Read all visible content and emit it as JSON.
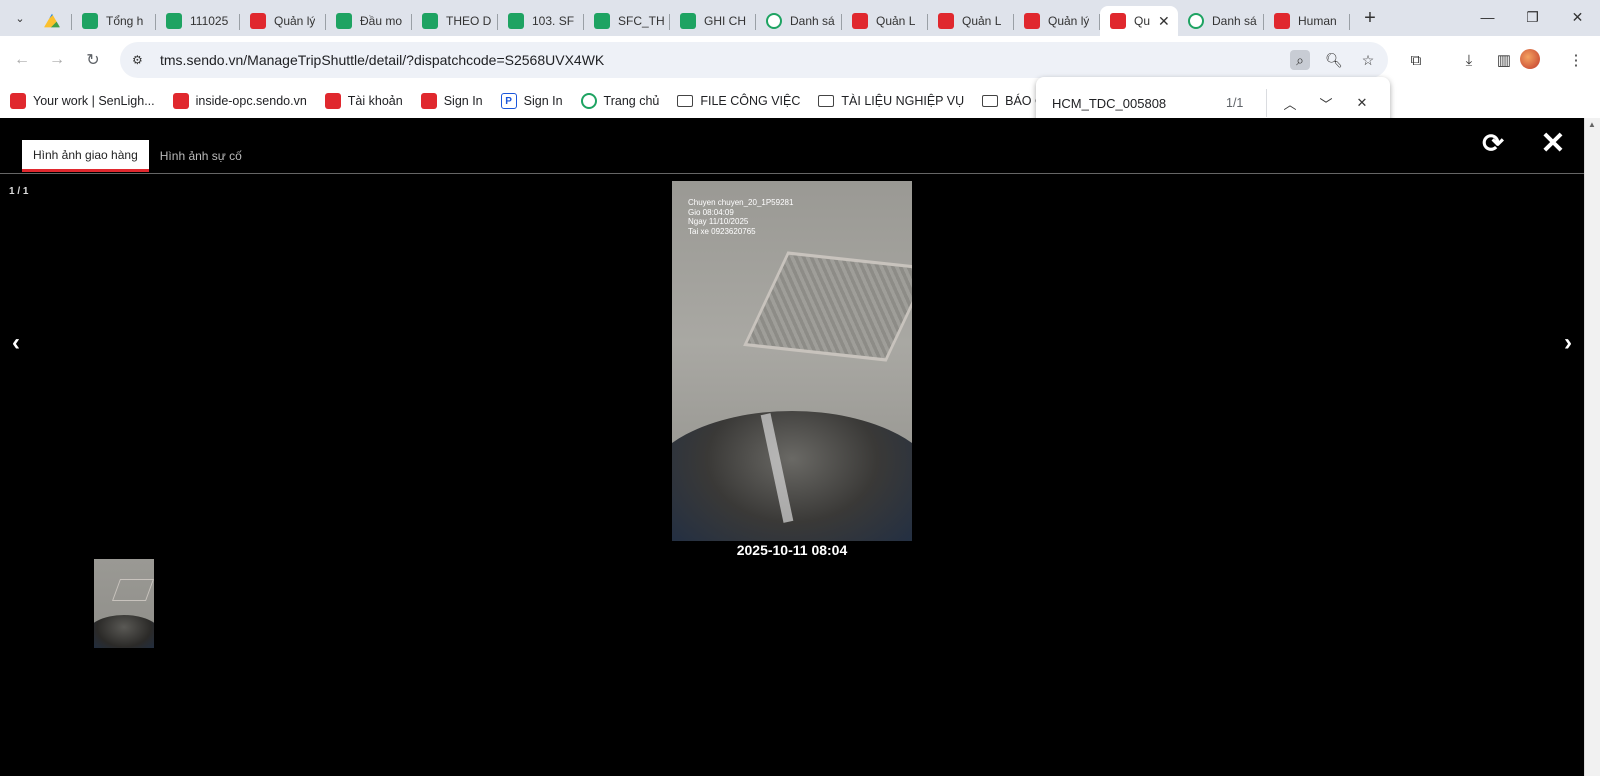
{
  "browser": {
    "tabs": [
      {
        "label": "",
        "icon": "google-drive-icon",
        "active": false
      },
      {
        "label": "Tổng h",
        "icon": "sheets-icon",
        "active": false
      },
      {
        "label": "111025",
        "icon": "sheets-icon",
        "active": false
      },
      {
        "label": "Quản lý",
        "icon": "sendo-icon",
        "active": false
      },
      {
        "label": "Đầu mo",
        "icon": "sheets-icon",
        "active": false
      },
      {
        "label": "THEO D",
        "icon": "sheets-icon",
        "active": false
      },
      {
        "label": "103. SF",
        "icon": "sheets-icon",
        "active": false
      },
      {
        "label": "SFC_TH",
        "icon": "sheets-icon",
        "active": false
      },
      {
        "label": "GHI CH",
        "icon": "sheets-icon",
        "active": false
      },
      {
        "label": "Danh sá",
        "icon": "green-ring-icon",
        "active": false
      },
      {
        "label": "Quản L",
        "icon": "sendo-icon",
        "active": false
      },
      {
        "label": "Quản L",
        "icon": "sendo-icon",
        "active": false
      },
      {
        "label": "Quản lý",
        "icon": "sendo-icon",
        "active": false
      },
      {
        "label": "Qu",
        "icon": "sendo-icon",
        "active": true
      },
      {
        "label": "Danh sá",
        "icon": "green-ring-icon",
        "active": false
      },
      {
        "label": "Human",
        "icon": "sendo-icon",
        "active": false
      }
    ],
    "url": "tms.sendo.vn/ManageTripShuttle/detail/?dispatchcode=S2568UVX4WK",
    "bookmarks": [
      {
        "label": "Your work | SenLigh...",
        "icon": "sendo"
      },
      {
        "label": "inside-opc.sendo.vn",
        "icon": "sendo"
      },
      {
        "label": "Tài khoản",
        "icon": "sendo"
      },
      {
        "label": "Sign In",
        "icon": "sendo"
      },
      {
        "label": "Sign In",
        "icon": "p"
      },
      {
        "label": "Trang chủ",
        "icon": "ring"
      },
      {
        "label": "FILE CÔNG VIỆC",
        "icon": "folder"
      },
      {
        "label": "TÀI LIỆU NGHIỆP VỤ",
        "icon": "folder"
      },
      {
        "label": "BÁO CÁO",
        "icon": "folder"
      }
    ],
    "find": {
      "query": "HCM_TDC_005808",
      "count": "1/1"
    }
  },
  "viewer": {
    "tabs": [
      {
        "label": "Hình ảnh giao hàng",
        "active": true
      },
      {
        "label": "Hình ảnh sự cố",
        "active": false
      }
    ],
    "counter": "1 / 1",
    "photo_overlay": [
      "Chuyen chuyen_20_1P59281",
      "Gio 08:04:09",
      "Ngay 11/10/2025",
      "Tai xe 0923620765"
    ],
    "timestamp": "2025-10-11 08:04",
    "colors": {
      "accent": "#e0282e",
      "background": "#000000"
    }
  }
}
